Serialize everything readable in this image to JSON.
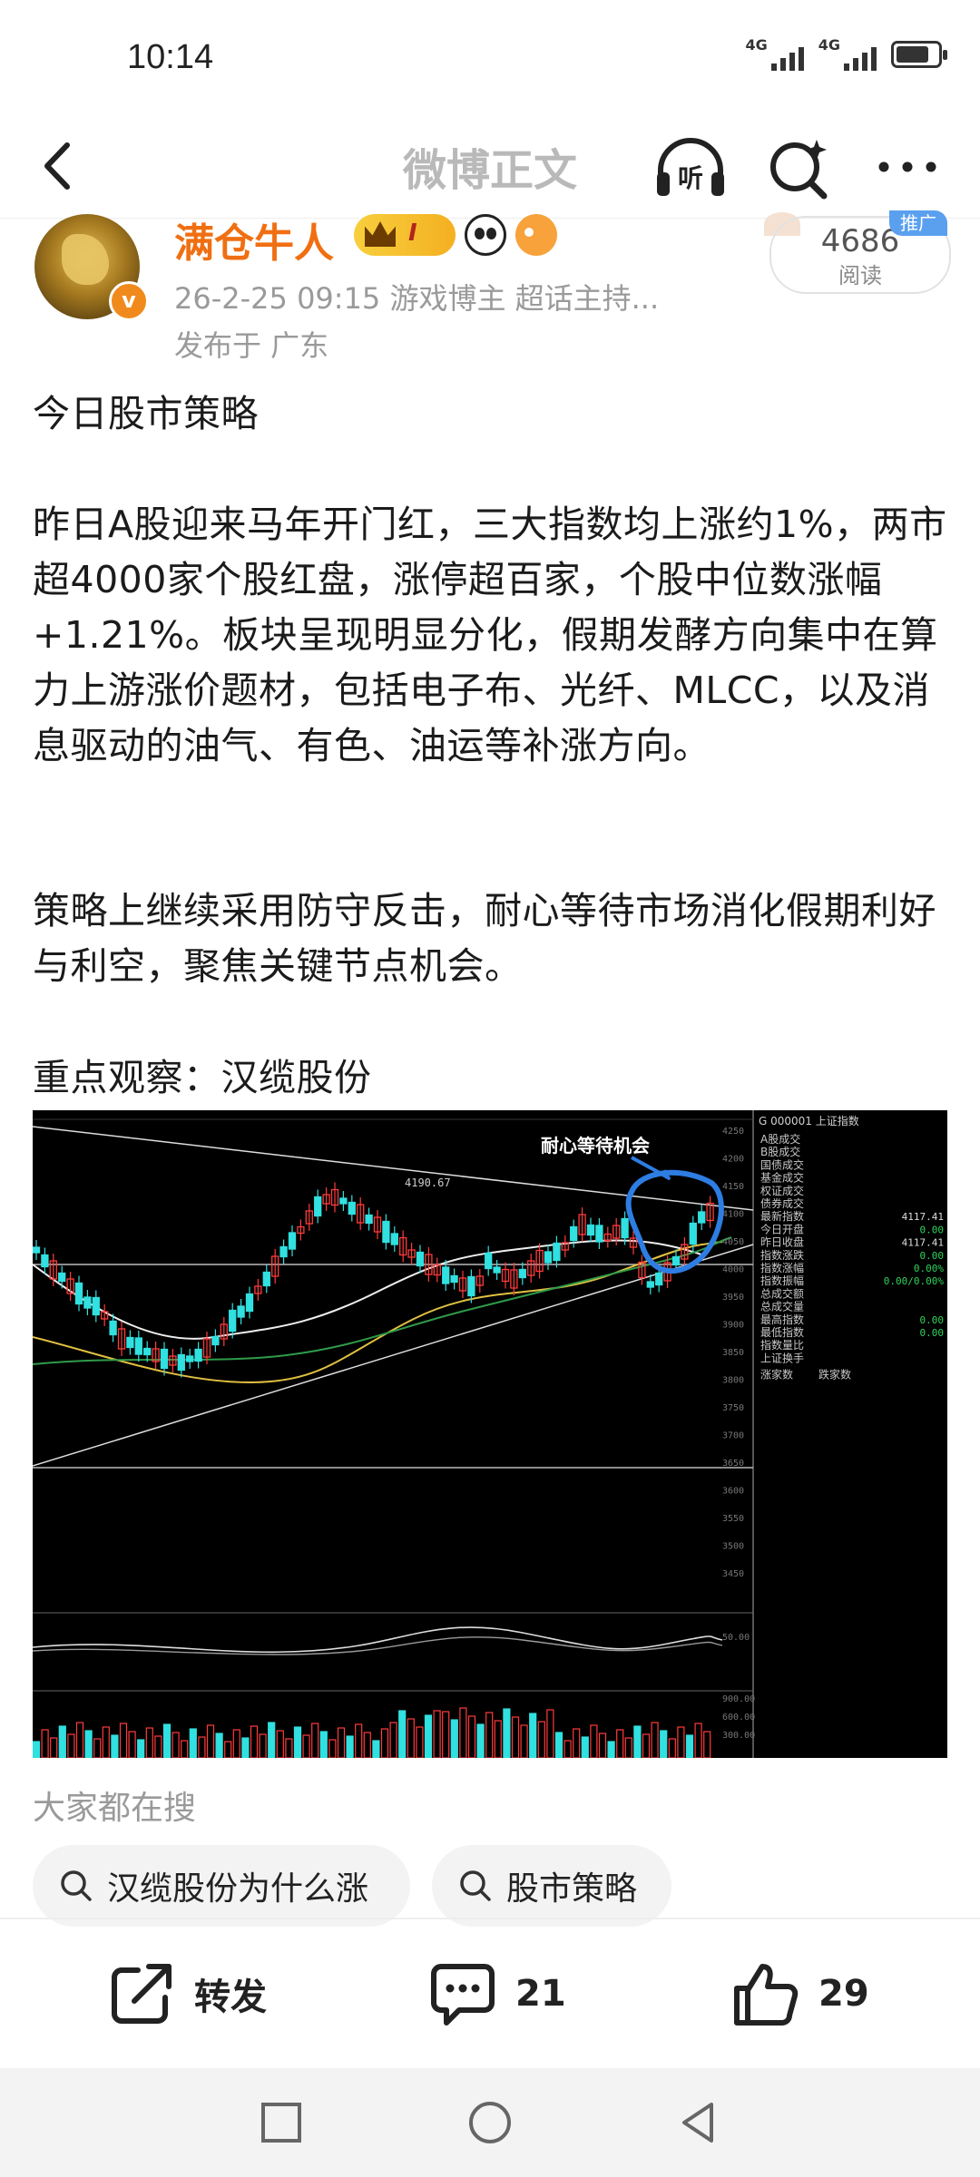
{
  "status_bar": {
    "time": "10:14",
    "signal_1": "4G",
    "signal_2": "4G"
  },
  "header": {
    "title": "微博正文",
    "listen_label": "听"
  },
  "author": {
    "name": "满仓牛人",
    "level_badge": "I",
    "meta": "26-2-25 09:15  游戏博主 超话主持...",
    "location": "发布于 广东",
    "verified": "v"
  },
  "read_stats": {
    "count": "4686",
    "label": "阅读",
    "tag": "推广"
  },
  "post": {
    "p1": "今日股市策略",
    "p2": "昨日A股迎来马年开门红，三大指数均上涨约1%，两市超4000家个股红盘，涨停超百家，个股中位数涨幅+1.21%。板块呈现明显分化，假期发酵方向集中在算力上游涨价题材，包括电子布、光纤、MLCC，以及消息驱动的油气、有色、油运等补涨方向。",
    "p3": "策略上继续采用防守反击，耐心等待市场消化假期利好与利空，聚焦关键节点机会。",
    "p4": "重点观察：汉缆股份"
  },
  "chart_image": {
    "annotation": "耐心等待机会",
    "panel_header": "G 000001 上证指数",
    "price_labels": [
      "4250",
      "4200",
      "4150",
      "4100",
      "4050",
      "4000",
      "3950",
      "3900",
      "3850",
      "3800",
      "3750",
      "3700",
      "3650",
      "3600",
      "3550",
      "3500",
      "3450"
    ],
    "panel_rows": [
      {
        "label": "A股成交",
        "value": ""
      },
      {
        "label": "B股成交",
        "value": ""
      },
      {
        "label": "国债成交",
        "value": ""
      },
      {
        "label": "基金成交",
        "value": ""
      },
      {
        "label": "权证成交",
        "value": ""
      },
      {
        "label": "债券成交",
        "value": ""
      },
      {
        "label": "最新指数",
        "value": "4117.41"
      },
      {
        "label": "今日开盘",
        "value": "0.00"
      },
      {
        "label": "昨日收盘",
        "value": "4117.41"
      },
      {
        "label": "指数涨跌",
        "value": "0.00"
      },
      {
        "label": "指数涨幅",
        "value": "0.00%"
      },
      {
        "label": "指数振幅",
        "value": "0.00/0.00%"
      },
      {
        "label": "总成交额",
        "value": ""
      },
      {
        "label": "总成交量",
        "value": ""
      },
      {
        "label": "最高指数",
        "value": "0.00"
      },
      {
        "label": "最低指数",
        "value": "0.00"
      },
      {
        "label": "指数量比",
        "value": ""
      },
      {
        "label": "上证换手",
        "value": ""
      }
    ],
    "panel_footer": [
      "涨家数",
      "跌家数"
    ],
    "peak_label": "4190.67",
    "osc_label": "50.00",
    "vol_labels": [
      "900.00",
      "600.00",
      "300.00"
    ]
  },
  "search_section": {
    "title": "大家都在搜",
    "chips": [
      "汉缆股份为什么涨",
      "股市策略"
    ]
  },
  "actions": {
    "repost": "转发",
    "comments": "21",
    "likes": "29"
  }
}
